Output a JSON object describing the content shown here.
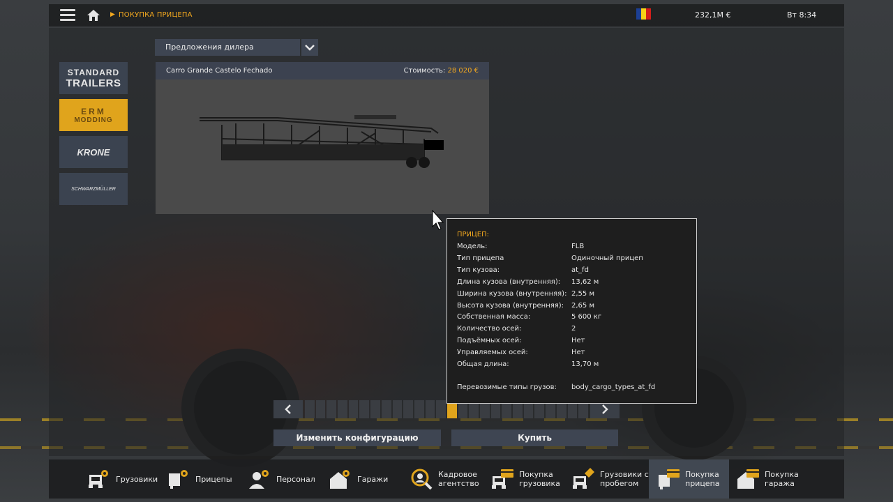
{
  "topbar": {
    "breadcrumb": "ПОКУПКА ПРИЦЕПА",
    "money": "232,1M  €",
    "clock": "Вт 8:34",
    "flag_colors": [
      "#1c3f94",
      "#f7d117",
      "#d21f1b"
    ]
  },
  "brands": [
    {
      "name": "STANDARD TRAILERS",
      "line1": "STANDARD",
      "line2": "TRAILERS"
    },
    {
      "name": "ERM MODDING",
      "line1": "ERM",
      "line2": "MODDING"
    },
    {
      "name": "KRONE",
      "line1": "KRONE"
    },
    {
      "name": "SCHWARZMÜLLER",
      "line1": "SCHWARZMÜLLER"
    }
  ],
  "dealer": {
    "selected": "Предложения дилера"
  },
  "preview": {
    "trailer_name": "Carro Grande Castelo Fechado",
    "price_label": "Стоимость: ",
    "price_value": "28 020 €"
  },
  "pager": {
    "total": 26,
    "active_index": 13
  },
  "buttons": {
    "configure": "Изменить конфигурацию",
    "buy": "Купить"
  },
  "tooltip": {
    "title": "ПРИЦЕП:",
    "rows": [
      {
        "k": "Модель:",
        "v": "FLB"
      },
      {
        "k": "Тип прицепа",
        "v": "Одиночный прицеп"
      },
      {
        "k": "Тип кузова:",
        "v": "at_fd"
      },
      {
        "k": "Длина кузова (внутренняя):",
        "v": "13,62 м"
      },
      {
        "k": "Ширина кузова (внутренняя):",
        "v": "2,55 м"
      },
      {
        "k": "Высота кузова (внутренняя):",
        "v": "2,65 м"
      },
      {
        "k": "Собственная масса:",
        "v": "5 600 кг"
      },
      {
        "k": "Количество осей:",
        "v": "2"
      },
      {
        "k": "Подъёмных осей:",
        "v": "Нет"
      },
      {
        "k": "Управляемых осей:",
        "v": "Нет"
      },
      {
        "k": "Общая длина:",
        "v": "13,70 м"
      },
      {
        "k": "Перевозимые типы грузов:",
        "v": "body_cargo_types_at_fd"
      }
    ]
  },
  "nav": [
    {
      "label1": "Грузовики",
      "label2": ""
    },
    {
      "label1": "Прицепы",
      "label2": ""
    },
    {
      "label1": "Персонал",
      "label2": ""
    },
    {
      "label1": "Гаражи",
      "label2": ""
    },
    {
      "label1": "Кадровое",
      "label2": "агентство"
    },
    {
      "label1": "Покупка",
      "label2": "грузовика"
    },
    {
      "label1": "Грузовики с",
      "label2": "пробегом"
    },
    {
      "label1": "Покупка",
      "label2": "прицепа"
    },
    {
      "label1": "Покупка",
      "label2": "гаража"
    }
  ],
  "colors": {
    "accent": "#f2a81f",
    "button_bg": "#3e4552"
  }
}
